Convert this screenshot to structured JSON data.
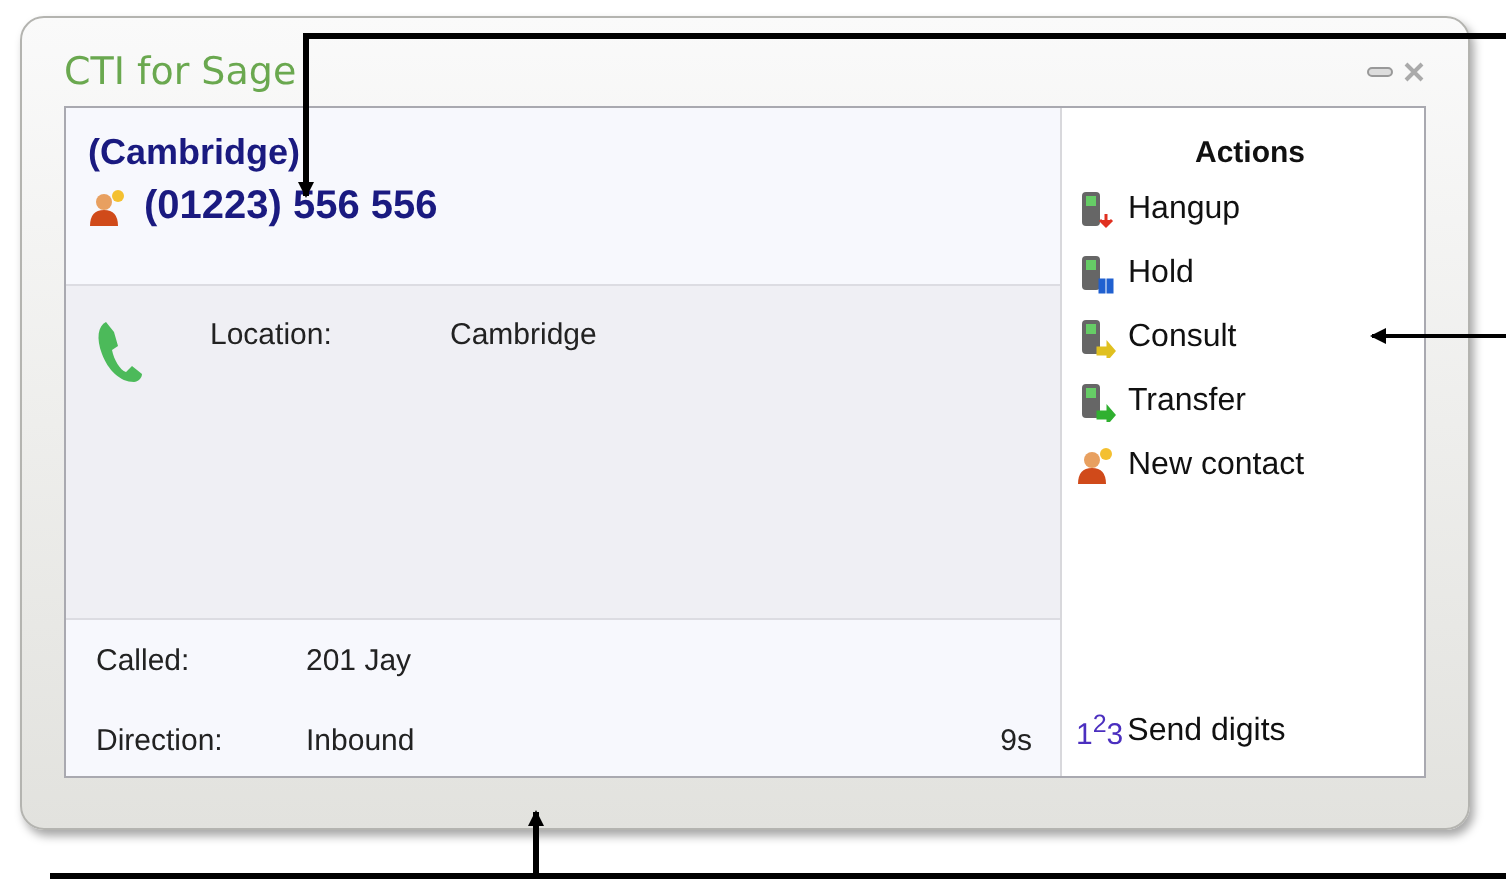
{
  "window": {
    "title": "CTI for Sage"
  },
  "caller": {
    "name": "(Cambridge)",
    "number": "(01223) 556 556"
  },
  "details": [
    {
      "label": "Location:",
      "value": "Cambridge"
    }
  ],
  "footer": [
    {
      "label": "Called:",
      "value": "201  Jay"
    },
    {
      "label": "Direction:",
      "value": "Inbound",
      "duration": "9s"
    }
  ],
  "actions": {
    "title": "Actions",
    "items": [
      {
        "kind": "hangup",
        "label": "Hangup"
      },
      {
        "kind": "hold",
        "label": "Hold"
      },
      {
        "kind": "consult",
        "label": "Consult"
      },
      {
        "kind": "transfer",
        "label": "Transfer"
      },
      {
        "kind": "contact",
        "label": "New contact"
      }
    ],
    "send_digits": {
      "glyph": "1$^{2}$3",
      "label": "Send digits"
    }
  }
}
